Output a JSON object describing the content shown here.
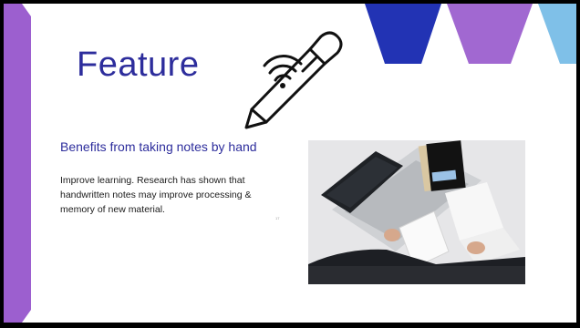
{
  "slide": {
    "title": "Feature",
    "subheading": "Benefits from taking notes by hand",
    "body": "Improve learning. Research has shown that handwritten notes may improve processing & memory of new material.",
    "footnote": "17"
  },
  "icons": {
    "pen": "smart-pen-icon",
    "image": "laptop-notes-photo"
  },
  "colors": {
    "title": "#2d2d9c",
    "accent_purple": "#9c5fcf",
    "hex_blue": "#2233b4",
    "hex_purple": "#a168d1",
    "hex_light_blue": "#7fc0e8",
    "frame": "#000000"
  }
}
